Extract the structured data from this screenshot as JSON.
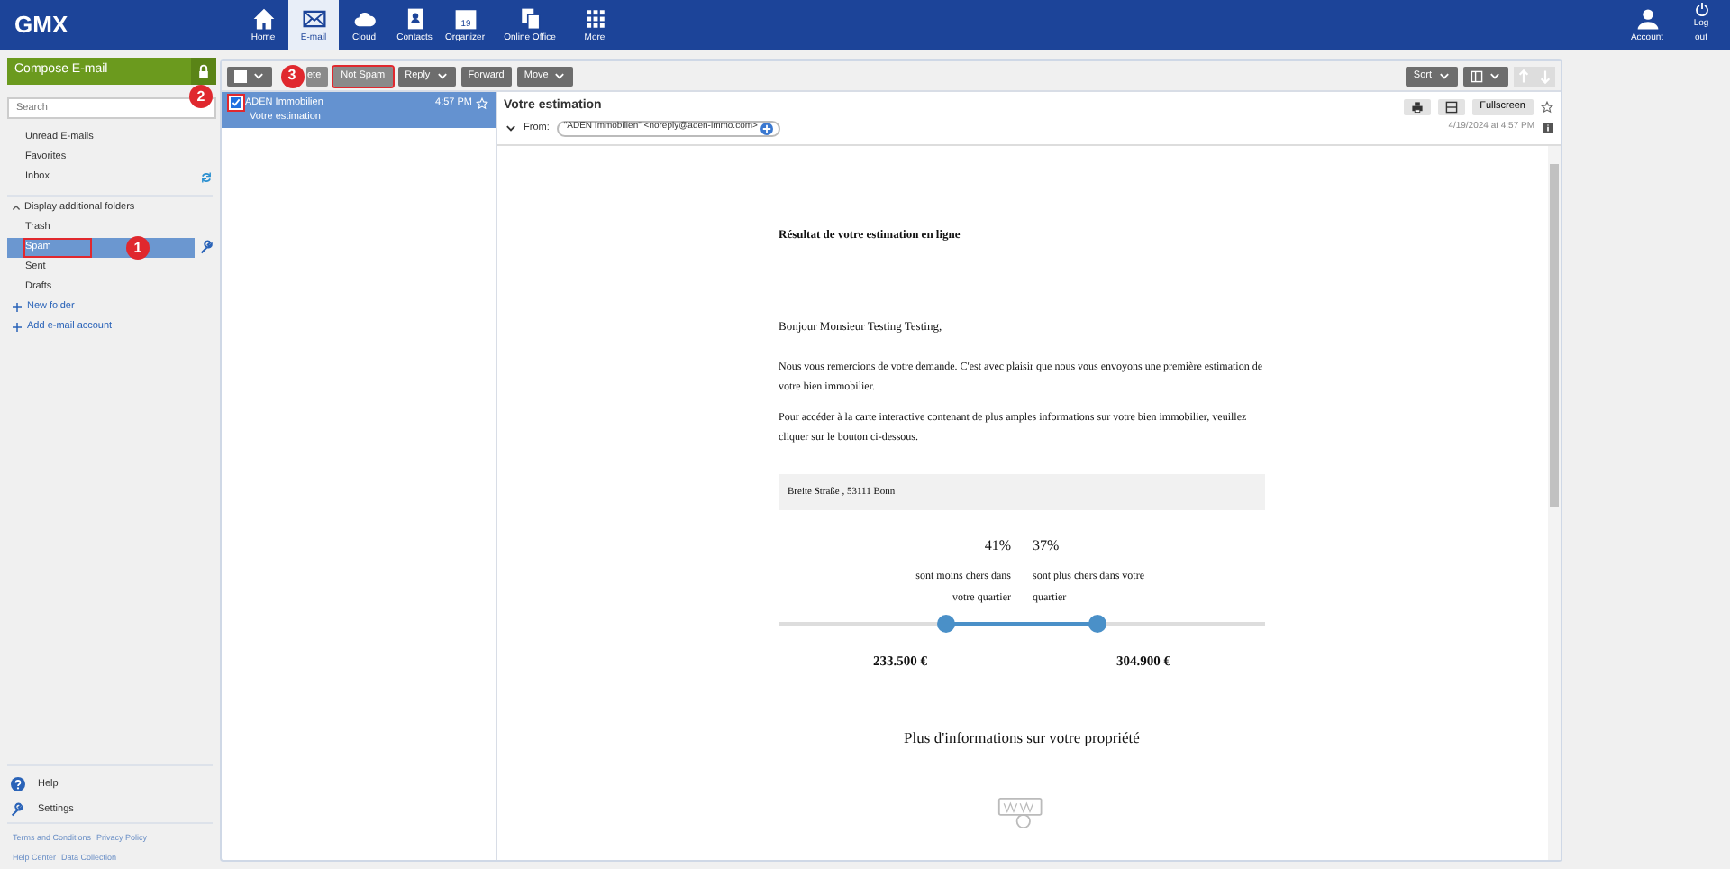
{
  "topbar": {
    "logo": "GMX",
    "nav": [
      {
        "label": "Home",
        "kind": "home",
        "selected": false
      },
      {
        "label": "E-mail",
        "kind": "mail",
        "selected": true
      },
      {
        "label": "Cloud",
        "kind": "cloud",
        "selected": false
      },
      {
        "label": "Contacts",
        "kind": "contacts",
        "selected": false
      },
      {
        "label": "Organizer",
        "kind": "calendar",
        "selected": false,
        "badge": "19"
      },
      {
        "label": "Online Office",
        "kind": "office",
        "selected": false
      },
      {
        "label": "More",
        "kind": "grid",
        "selected": false
      }
    ],
    "user": [
      {
        "label": "Account",
        "kind": "person"
      },
      {
        "label": "Log out",
        "kind": "power"
      }
    ]
  },
  "sidebar": {
    "compose": "Compose E-mail",
    "search": {
      "placeholder": "Search",
      "marker": "2"
    },
    "folders": [
      {
        "label": "Unread E-mails",
        "selected": false
      },
      {
        "label": "Favorites",
        "selected": false
      },
      {
        "label": "Inbox",
        "selected": false,
        "refresh": true
      }
    ],
    "more_toggle": {
      "label": "Display additional folders",
      "expanded": true
    },
    "more_folders": [
      {
        "label": "Trash",
        "selected": false,
        "highlighted": false
      },
      {
        "label": "Spam",
        "selected": true,
        "highlighted": true,
        "marker": "1"
      },
      {
        "label": "Sent",
        "selected": false,
        "highlighted": false
      },
      {
        "label": "Drafts",
        "selected": false,
        "highlighted": false
      }
    ],
    "actions": [
      {
        "label": "New folder"
      },
      {
        "label": "Add e-mail account"
      }
    ],
    "bottom": [
      {
        "label": "Help",
        "kind": "help"
      },
      {
        "label": "Settings",
        "kind": "wrench"
      }
    ],
    "links": [
      [
        "Terms and Conditions",
        "Privacy Policy"
      ],
      [
        "Help Center",
        "Data Collection"
      ]
    ]
  },
  "toolbar": {
    "select_all": {
      "checked": false
    },
    "buttons": [
      {
        "label": "ete",
        "highlighted": false,
        "marker": "3"
      },
      {
        "label": "Not Spam",
        "highlighted": true
      },
      {
        "label": "Reply",
        "dropdown": true,
        "highlighted": false
      },
      {
        "label": "Forward",
        "highlighted": false
      },
      {
        "label": "Move",
        "dropdown": true,
        "highlighted": false
      }
    ],
    "sort": "Sort"
  },
  "messages": [
    {
      "sender": "ADEN Immobilien",
      "time": "4:57 PM",
      "subject": "Votre estimation",
      "checked": true,
      "selected": true,
      "highlighted": true
    }
  ],
  "reading": {
    "subject": "Votre estimation",
    "fullscreen": "Fullscreen",
    "from_label": "From:",
    "from": "\"ADEN Immobilien\" <noreply@aden-immo.com>",
    "date": "4/19/2024 at 4:57 PM",
    "body": {
      "heading": "Résultat de votre estimation en ligne",
      "greeting": "Bonjour Monsieur Testing Testing,",
      "paragraphs": [
        "Nous vous remercions de votre demande. C'est avec plaisir que nous vous envoyons une première estimation de votre bien immobilier.",
        "Pour accéder à la carte interactive contenant de plus amples informations sur votre bien immobilier, veuillez cliquer sur le bouton ci-dessous."
      ],
      "address": "Breite Straße , 53111 Bonn",
      "ranges": [
        {
          "percent": "41%",
          "text": "sont moins chers dans votre quartier",
          "price": "233.500 €",
          "level": 0.344
        },
        {
          "percent": "37%",
          "text": "sont plus chers dans votre quartier",
          "price": "304.900 €",
          "level": 0.656
        }
      ],
      "more_info": "Plus d'informations sur votre propriété"
    }
  }
}
